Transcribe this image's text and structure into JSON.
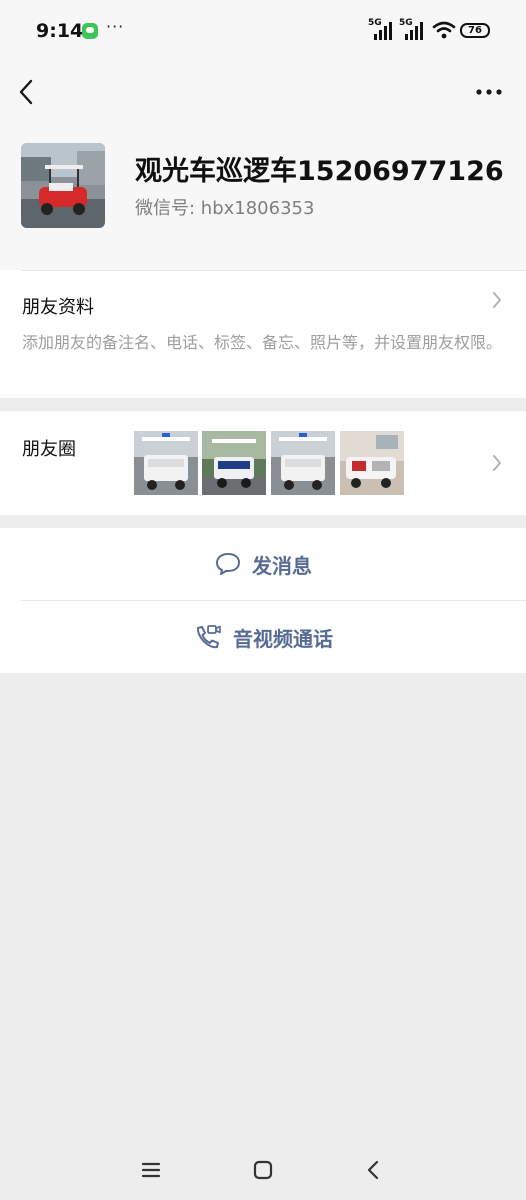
{
  "status_bar": {
    "time": "9:14",
    "overflow_indicator": "···",
    "signal_1_label": "5G",
    "signal_2_label": "5G",
    "battery_level": "76"
  },
  "header": {
    "back_icon": "chevron-left-icon",
    "more_icon": "more-dots-icon"
  },
  "profile": {
    "name": "观光车巡逻车15206977126",
    "wechat_id": "微信号: hbx1806353"
  },
  "friend_info": {
    "title": "朋友资料",
    "description": "添加朋友的备注名、电话、标签、备忘、照片等，并设置朋友权限。"
  },
  "moments": {
    "title": "朋友圈",
    "thumbnail_count": 4
  },
  "actions": {
    "message_label": "发消息",
    "call_label": "音视频通话"
  },
  "colors": {
    "accent_link": "#576b95",
    "background": "#ededed",
    "card": "#ffffff"
  }
}
